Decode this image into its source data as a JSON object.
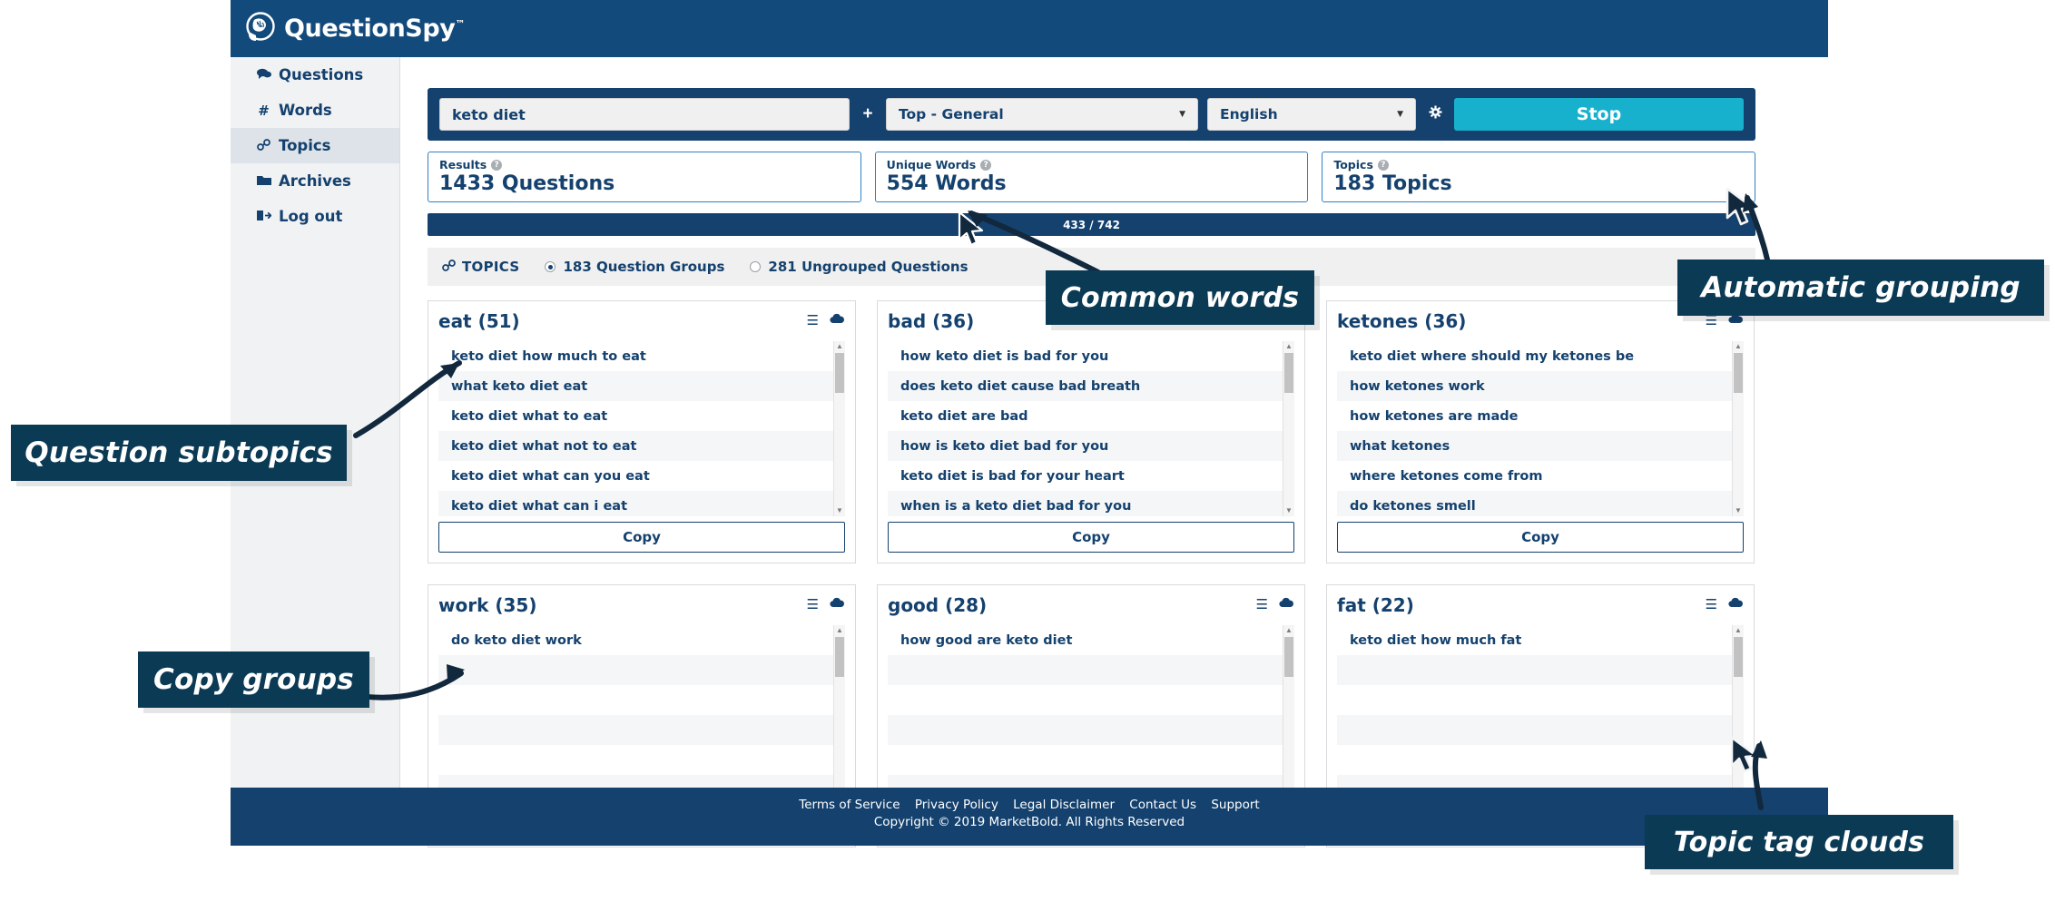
{
  "brand": {
    "name": "QuestionSpy",
    "tm": "™",
    "logo_icon": "brain-head-icon"
  },
  "sidebar": {
    "items": [
      {
        "label": "Questions",
        "icon": "comments-icon",
        "glyph": "💬",
        "active": false
      },
      {
        "label": "Words",
        "icon": "hash-icon",
        "glyph": "#",
        "active": false
      },
      {
        "label": "Topics",
        "icon": "link-icon",
        "glyph": "%",
        "active": true
      },
      {
        "label": "Archives",
        "icon": "folder-icon",
        "glyph": "▰",
        "active": false
      },
      {
        "label": "Log out",
        "icon": "sign-out-icon",
        "glyph": "↪",
        "active": false
      }
    ]
  },
  "search": {
    "keyword_value": "keto diet",
    "plus_label": "+",
    "category_value": "Top - General",
    "language_value": "English",
    "gear_icon": "gear-icon",
    "stop_label": "Stop",
    "caret": "▼"
  },
  "stats": [
    {
      "label": "Results",
      "value": "1433 Questions",
      "help_icon": "question-mark-icon"
    },
    {
      "label": "Unique Words",
      "value": "554 Words",
      "help_icon": "question-mark-icon"
    },
    {
      "label": "Topics",
      "value": "183 Topics",
      "help_icon": "question-mark-icon"
    }
  ],
  "progress": {
    "text": "433 / 742",
    "percent": 100
  },
  "topics_bar": {
    "title": "TOPICS",
    "title_icon": "link-icon",
    "option_grouped": "183 Question Groups",
    "option_ungrouped": "281 Ungrouped Questions",
    "selected": "grouped"
  },
  "cards": [
    {
      "title": "eat (51)",
      "list_icon": "list-icon",
      "cloud_icon": "cloud-icon",
      "copy_label": "Copy",
      "questions": [
        "keto diet how much to eat",
        "what keto diet eat",
        "keto diet what to eat",
        "keto diet what not to eat",
        "keto diet what can you eat",
        "keto diet what can i eat"
      ]
    },
    {
      "title": "bad (36)",
      "list_icon": "list-icon",
      "cloud_icon": "cloud-icon",
      "copy_label": "Copy",
      "questions": [
        "how keto diet is bad for you",
        "does keto diet cause bad breath",
        "keto diet are bad",
        "how is keto diet bad for you",
        "keto diet is bad for your heart",
        "when is a keto diet bad for you"
      ]
    },
    {
      "title": "ketones (36)",
      "list_icon": "list-icon",
      "cloud_icon": "cloud-icon",
      "copy_label": "Copy",
      "questions": [
        "keto diet where should my ketones be",
        "how ketones work",
        "how ketones are made",
        "what ketones",
        "where ketones come from",
        "do ketones smell"
      ]
    },
    {
      "title": "work (35)",
      "list_icon": "list-icon",
      "cloud_icon": "cloud-icon",
      "copy_label": "Copy",
      "questions": [
        "do keto diet work",
        "",
        "",
        "",
        "",
        ""
      ]
    },
    {
      "title": "good (28)",
      "list_icon": "list-icon",
      "cloud_icon": "cloud-icon",
      "copy_label": "Copy",
      "questions": [
        "how good are keto diet",
        "",
        "",
        "",
        "",
        ""
      ]
    },
    {
      "title": "fat (22)",
      "list_icon": "list-icon",
      "cloud_icon": "cloud-icon",
      "copy_label": "Copy",
      "questions": [
        "keto diet how much fat",
        "",
        "",
        "",
        "",
        ""
      ]
    }
  ],
  "footer": {
    "links": [
      "Terms of Service",
      "Privacy Policy",
      "Legal Disclaimer",
      "Contact Us",
      "Support"
    ],
    "copyright": "Copyright © 2019 MarketBold. All Rights Reserved"
  },
  "callouts": [
    {
      "id": "question-subtopics",
      "text": "Question subtopics"
    },
    {
      "id": "copy-groups",
      "text": "Copy groups"
    },
    {
      "id": "common-words",
      "text": "Common words"
    },
    {
      "id": "automatic-grouping",
      "text": "Automatic grouping"
    },
    {
      "id": "topic-tag-clouds",
      "text": "Topic tag clouds"
    }
  ],
  "colors": {
    "brand_navy": "#14416e",
    "topbar_navy": "#134a7c",
    "accent_cyan": "#17b1ce",
    "callout_navy": "#0b3a55",
    "stat_border": "#2f80c4"
  }
}
